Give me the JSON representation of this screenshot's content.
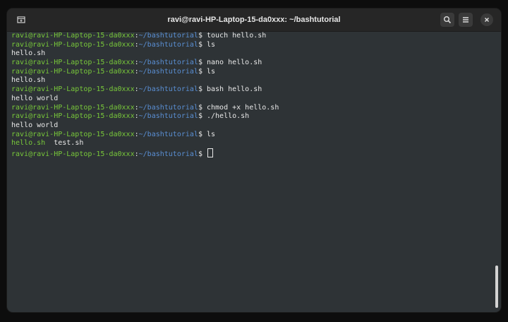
{
  "window": {
    "title": "ravi@ravi-HP-Laptop-15-da0xxx: ~/bashtutorial"
  },
  "prompt": {
    "user_host": "ravi@ravi-HP-Laptop-15-da0xxx",
    "separator": ":",
    "path": "~/bashtutorial",
    "symbol": "$ "
  },
  "lines": [
    {
      "type": "prompt",
      "cmd": "touch hello.sh"
    },
    {
      "type": "prompt",
      "cmd": "ls"
    },
    {
      "type": "output",
      "text": "hello.sh"
    },
    {
      "type": "prompt",
      "cmd": "nano hello.sh"
    },
    {
      "type": "prompt",
      "cmd": "ls"
    },
    {
      "type": "output",
      "text": "hello.sh"
    },
    {
      "type": "prompt",
      "cmd": "bash hello.sh"
    },
    {
      "type": "output",
      "text": "hello world"
    },
    {
      "type": "prompt",
      "cmd": "chmod +x hello.sh"
    },
    {
      "type": "prompt",
      "cmd": "./hello.sh"
    },
    {
      "type": "output",
      "text": "hello world"
    },
    {
      "type": "prompt",
      "cmd": "ls"
    },
    {
      "type": "listing",
      "items": [
        "hello.sh",
        "test.sh"
      ]
    },
    {
      "type": "prompt",
      "cmd": ""
    }
  ],
  "colors": {
    "prompt_user": "#78c83a",
    "prompt_path": "#5a8fd4",
    "executable_file": "#78c83a",
    "background": "#2e3336"
  },
  "icons": {
    "new_tab": "new-tab-icon",
    "search": "search-icon",
    "menu": "hamburger-menu-icon",
    "close": "close-icon"
  }
}
